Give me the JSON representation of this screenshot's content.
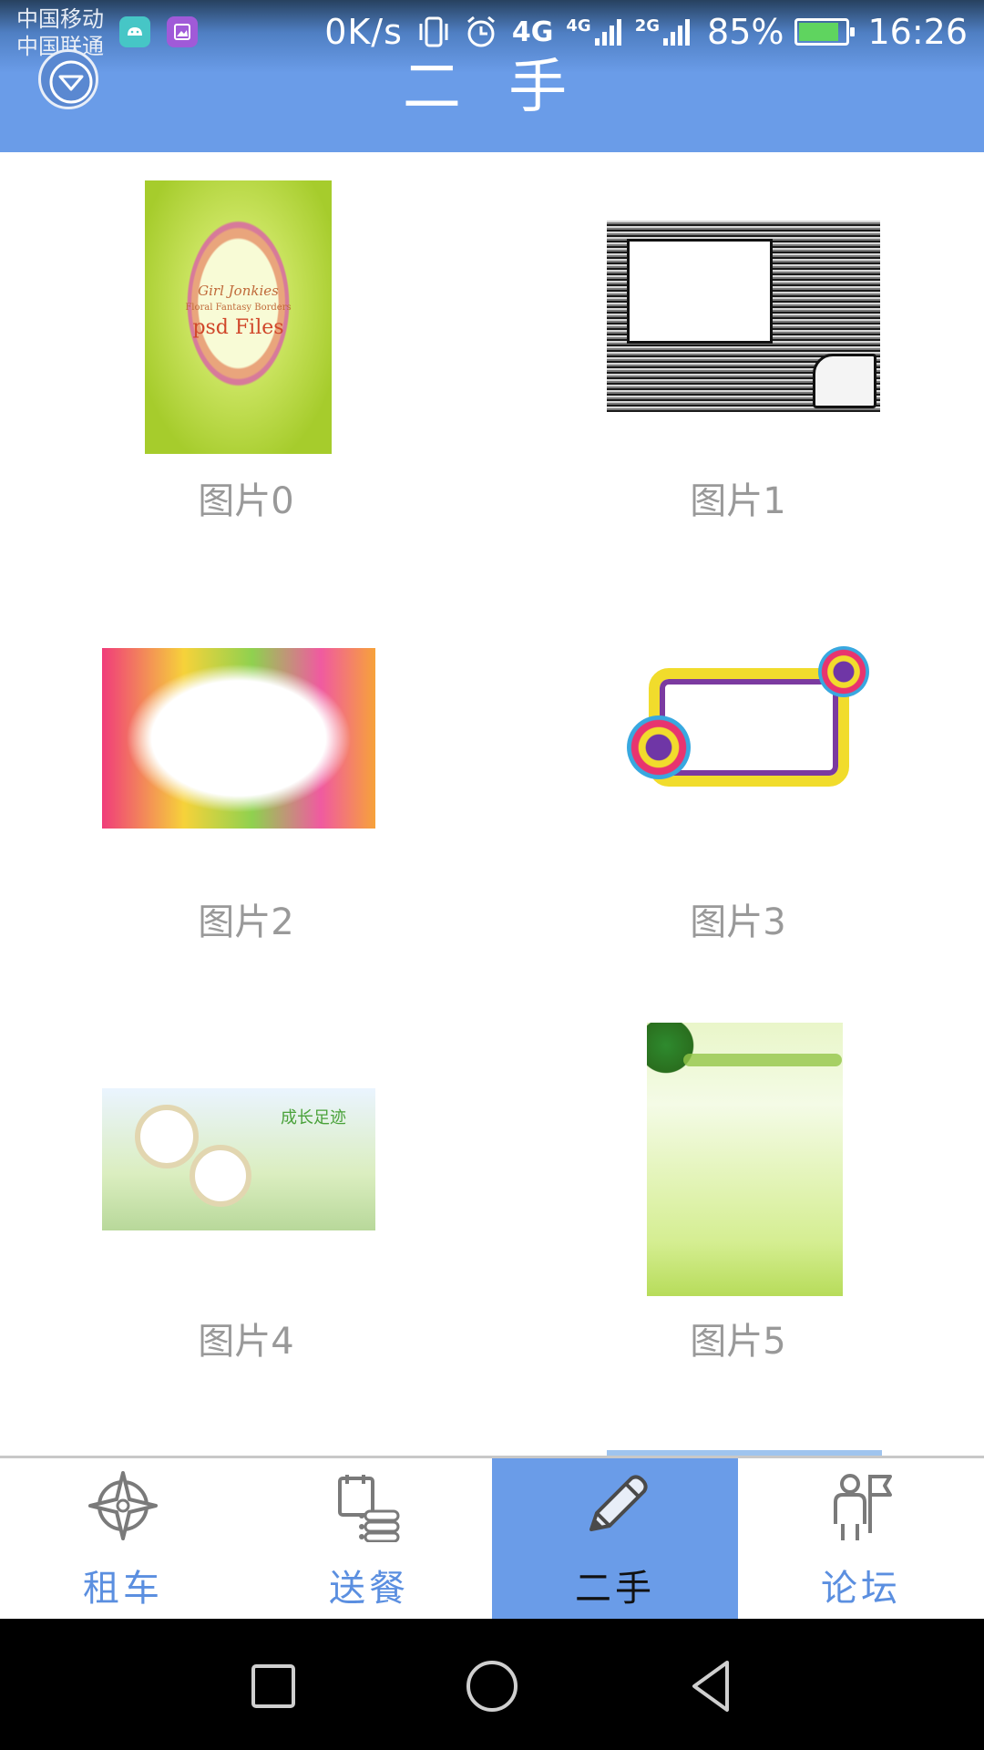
{
  "status_bar": {
    "carrier_1": "中国移动",
    "carrier_2": "中国联通",
    "net_speed": "0K/s",
    "sig1_label": "4G",
    "sig2_label": "4G",
    "sig3_label": "2G",
    "battery_pct": "85%",
    "time": "16:26",
    "battery_level": 0.85
  },
  "header": {
    "title": "二 手"
  },
  "grid": {
    "items": [
      {
        "caption": "图片0",
        "thumb_lines": [
          "Girl Jonkies",
          "Floral Fantasy Borders",
          "psd Files"
        ]
      },
      {
        "caption": "图片1"
      },
      {
        "caption": "图片2"
      },
      {
        "caption": "图片3"
      },
      {
        "caption": "图片4",
        "thumb_text": "成长足迹"
      },
      {
        "caption": "图片5"
      }
    ]
  },
  "bottom_nav": {
    "tabs": [
      {
        "label": "租车",
        "icon": "compass-icon"
      },
      {
        "label": "送餐",
        "icon": "clipboard-list-icon"
      },
      {
        "label": "二手",
        "icon": "pencil-icon",
        "active": true
      },
      {
        "label": "论坛",
        "icon": "person-flag-icon"
      }
    ]
  },
  "colors": {
    "accent": "#6a9ce8",
    "tab_label": "#5b8fe0",
    "caption": "#999999"
  }
}
